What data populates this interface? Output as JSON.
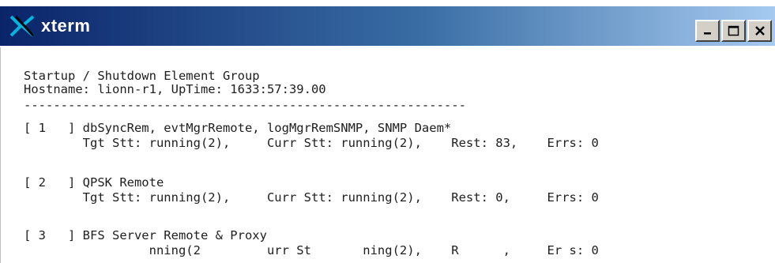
{
  "window": {
    "title": "xterm"
  },
  "icons": {
    "app": "xterm-logo-icon",
    "minimize": "minimize-icon",
    "maximize": "maximize-icon",
    "close": "close-icon"
  },
  "terminal": {
    "header": [
      "Startup / Shutdown Element Group",
      "Hostname: lionn-r1, UpTime: 1633:57:39.00",
      "------------------------------------------------------------"
    ],
    "entries": [
      {
        "id": "[ 1   ] dbSyncRem, evtMgrRemote, logMgrRemSNMP, SNMP Daem*",
        "status": "        Tgt Stt: running(2),     Curr Stt: running(2),    Rest: 83,    Errs: 0"
      },
      {
        "id": "[ 2   ] QPSK Remote",
        "status": "        Tgt Stt: running(2),     Curr Stt: running(2),    Rest: 0,     Errs: 0"
      },
      {
        "id": "[ 3   ] BFS Server Remote & Proxy",
        "status": "                 nning(2         urr St       ning(2),    R      ,     Er s: 0"
      }
    ]
  },
  "colors": {
    "titlebar_start": "#0a246a",
    "titlebar_end": "#a6caf0",
    "text": "#202020",
    "logo": "#00b4e0"
  }
}
